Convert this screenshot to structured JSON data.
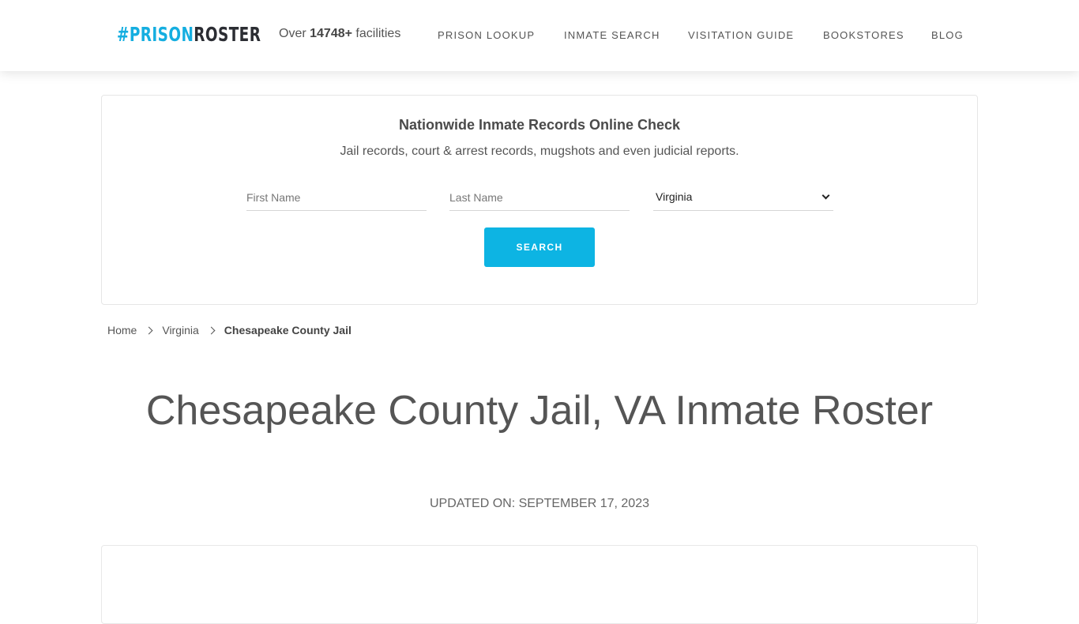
{
  "header": {
    "logo_part1": "#PRISON",
    "logo_part2": "ROSTER",
    "tagline_prefix": "Over ",
    "tagline_count": "14748+",
    "tagline_suffix": " facilities",
    "nav": [
      {
        "label": "PRISON LOOKUP"
      },
      {
        "label": "INMATE SEARCH"
      },
      {
        "label": "VISITATION GUIDE"
      },
      {
        "label": "BOOKSTORES"
      },
      {
        "label": "BLOG"
      }
    ]
  },
  "search": {
    "title": "Nationwide Inmate Records Online Check",
    "subtitle": "Jail records, court & arrest records, mugshots and even judicial reports.",
    "first_name_placeholder": "First Name",
    "first_name_value": "",
    "last_name_placeholder": "Last Name",
    "last_name_value": "",
    "state_selected": "Virginia",
    "button_label": "SEARCH"
  },
  "breadcrumb": {
    "items": [
      {
        "label": "Home"
      },
      {
        "label": "Virginia"
      },
      {
        "label": "Chesapeake County Jail"
      }
    ]
  },
  "page": {
    "title": "Chesapeake County Jail, VA Inmate Roster",
    "updated": "UPDATED ON: SEPTEMBER 17, 2023"
  },
  "colors": {
    "brand_blue": "#15aee0",
    "brand_dark": "#2b2d33",
    "button_bg": "#0db4e3",
    "text": "#555555"
  }
}
